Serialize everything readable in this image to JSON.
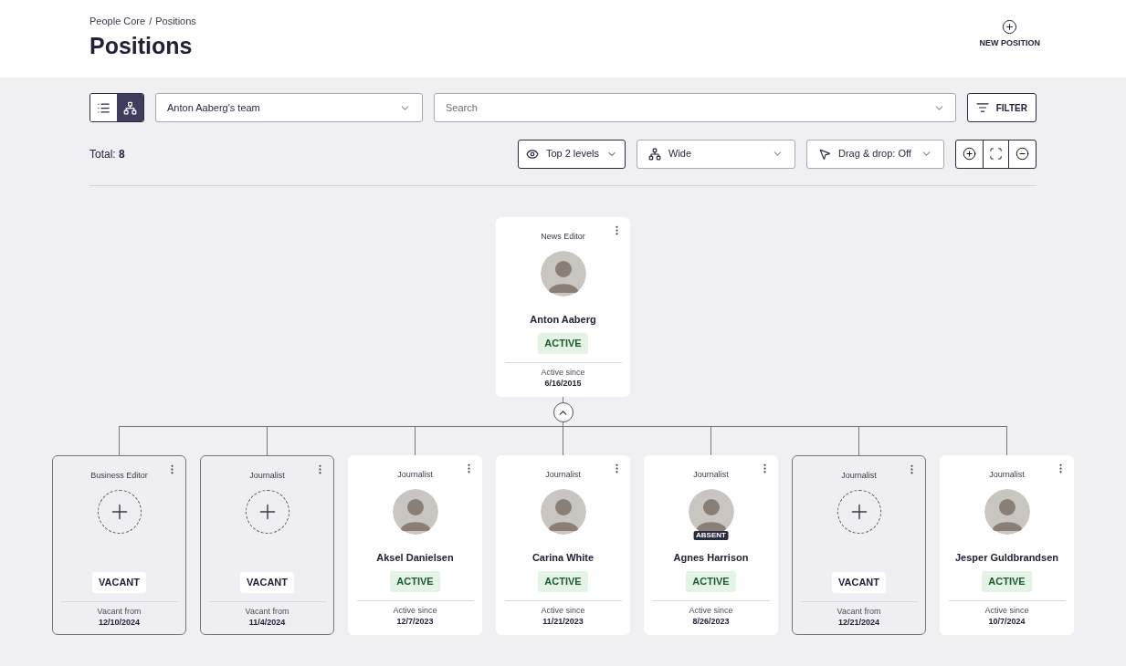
{
  "breadcrumb": [
    "People Core",
    "Positions"
  ],
  "breadcrumb_separator": "/",
  "title": "Positions",
  "new_position_button": "NEW POSITION",
  "view_toggle": [
    {
      "kind": "list",
      "selected": false
    },
    {
      "kind": "chart",
      "selected": true
    }
  ],
  "team_select": "Anton Aaberg's team",
  "search": {
    "placeholder": "Search"
  },
  "filter_button": "FILTER",
  "total": {
    "label": "Total:",
    "value": "8"
  },
  "levels_select": "Top 2 levels",
  "layout_select": "Wide",
  "drag_drop_select": "Drag & drop: Off",
  "root": {
    "kind": "person",
    "role": "News Editor",
    "name": "Anton Aaberg",
    "status": "ACTIVE",
    "since_label": "Active since",
    "date": "6/16/2015"
  },
  "expanded": true,
  "children": [
    {
      "kind": "vacant",
      "role": "Business Editor",
      "status": "VACANT",
      "since_label": "Vacant from",
      "date": "12/10/2024"
    },
    {
      "kind": "vacant",
      "role": "Journalist",
      "status": "VACANT",
      "since_label": "Vacant from",
      "date": "11/4/2024"
    },
    {
      "kind": "person",
      "role": "Journalist",
      "name": "Aksel Danielsen",
      "status": "ACTIVE",
      "since_label": "Active since",
      "date": "12/7/2023",
      "absent": false
    },
    {
      "kind": "person",
      "role": "Journalist",
      "name": "Carina White",
      "status": "ACTIVE",
      "since_label": "Active since",
      "date": "11/21/2023",
      "absent": false
    },
    {
      "kind": "person",
      "role": "Journalist",
      "name": "Agnes Harrison",
      "status": "ACTIVE",
      "since_label": "Active since",
      "date": "8/26/2023",
      "absent": true,
      "absent_label": "ABSENT"
    },
    {
      "kind": "vacant",
      "role": "Journalist",
      "status": "VACANT",
      "since_label": "Vacant from",
      "date": "12/21/2024"
    },
    {
      "kind": "person",
      "role": "Journalist",
      "name": "Jesper Guldbrandsen",
      "status": "ACTIVE",
      "since_label": "Active since",
      "date": "10/7/2024",
      "absent": false
    }
  ]
}
